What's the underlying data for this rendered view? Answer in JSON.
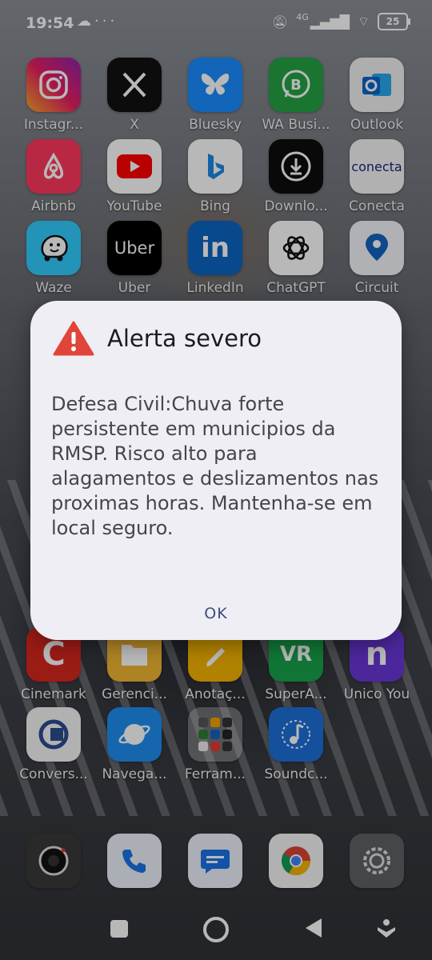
{
  "status_bar": {
    "time": "19:54",
    "network": "4G",
    "battery": "25"
  },
  "rows": [
    [
      {
        "label": "Instagr...",
        "icon": "instagram-icon"
      },
      {
        "label": "X",
        "icon": "x-icon"
      },
      {
        "label": "Bluesky",
        "icon": "bluesky-icon"
      },
      {
        "label": "WA Busi...",
        "icon": "whatsapp-business-icon"
      },
      {
        "label": "Outlook",
        "icon": "outlook-icon"
      }
    ],
    [
      {
        "label": "Airbnb",
        "icon": "airbnb-icon"
      },
      {
        "label": "YouTube",
        "icon": "youtube-icon"
      },
      {
        "label": "Bing",
        "icon": "bing-icon"
      },
      {
        "label": "Downlo...",
        "icon": "download-icon"
      },
      {
        "label": "Conecta",
        "icon": "conecta-icon",
        "icon_text": "conecta"
      }
    ],
    [
      {
        "label": "Waze",
        "icon": "waze-icon"
      },
      {
        "label": "Uber",
        "icon": "uber-icon",
        "icon_text": "Uber"
      },
      {
        "label": "LinkedIn",
        "icon": "linkedin-icon",
        "icon_text": "in"
      },
      {
        "label": "ChatGPT",
        "icon": "chatgpt-icon"
      },
      {
        "label": "Circuit",
        "icon": "circuit-icon"
      }
    ],
    [
      {
        "label": "Cinemark",
        "icon": "cinemark-icon",
        "icon_text": "C"
      },
      {
        "label": "Gerenci...",
        "icon": "gerenciador-icon"
      },
      {
        "label": "Anotaç...",
        "icon": "notes-icon"
      },
      {
        "label": "SuperA...",
        "icon": "superapp-icon",
        "icon_text": "VR"
      },
      {
        "label": "Unico You",
        "icon": "unico-icon",
        "icon_text": "n"
      }
    ],
    [
      {
        "label": "Convers...",
        "icon": "converter-icon"
      },
      {
        "label": "Navega...",
        "icon": "browser-icon"
      },
      {
        "label": "Ferram...",
        "icon": "tools-folder-icon"
      },
      {
        "label": "Soundc...",
        "icon": "soundcloud-icon"
      }
    ]
  ],
  "dock": [
    {
      "icon": "camera-icon"
    },
    {
      "icon": "phone-icon"
    },
    {
      "icon": "messages-icon"
    },
    {
      "icon": "chrome-icon"
    },
    {
      "icon": "settings-icon"
    }
  ],
  "alert": {
    "title": "Alerta severo",
    "body": "Defesa Civil:Chuva forte persistente em municipios da RMSP. Risco alto para alagamentos e deslizamentos nas proximas horas. Mantenha-se em local seguro.",
    "ok_label": "OK"
  }
}
